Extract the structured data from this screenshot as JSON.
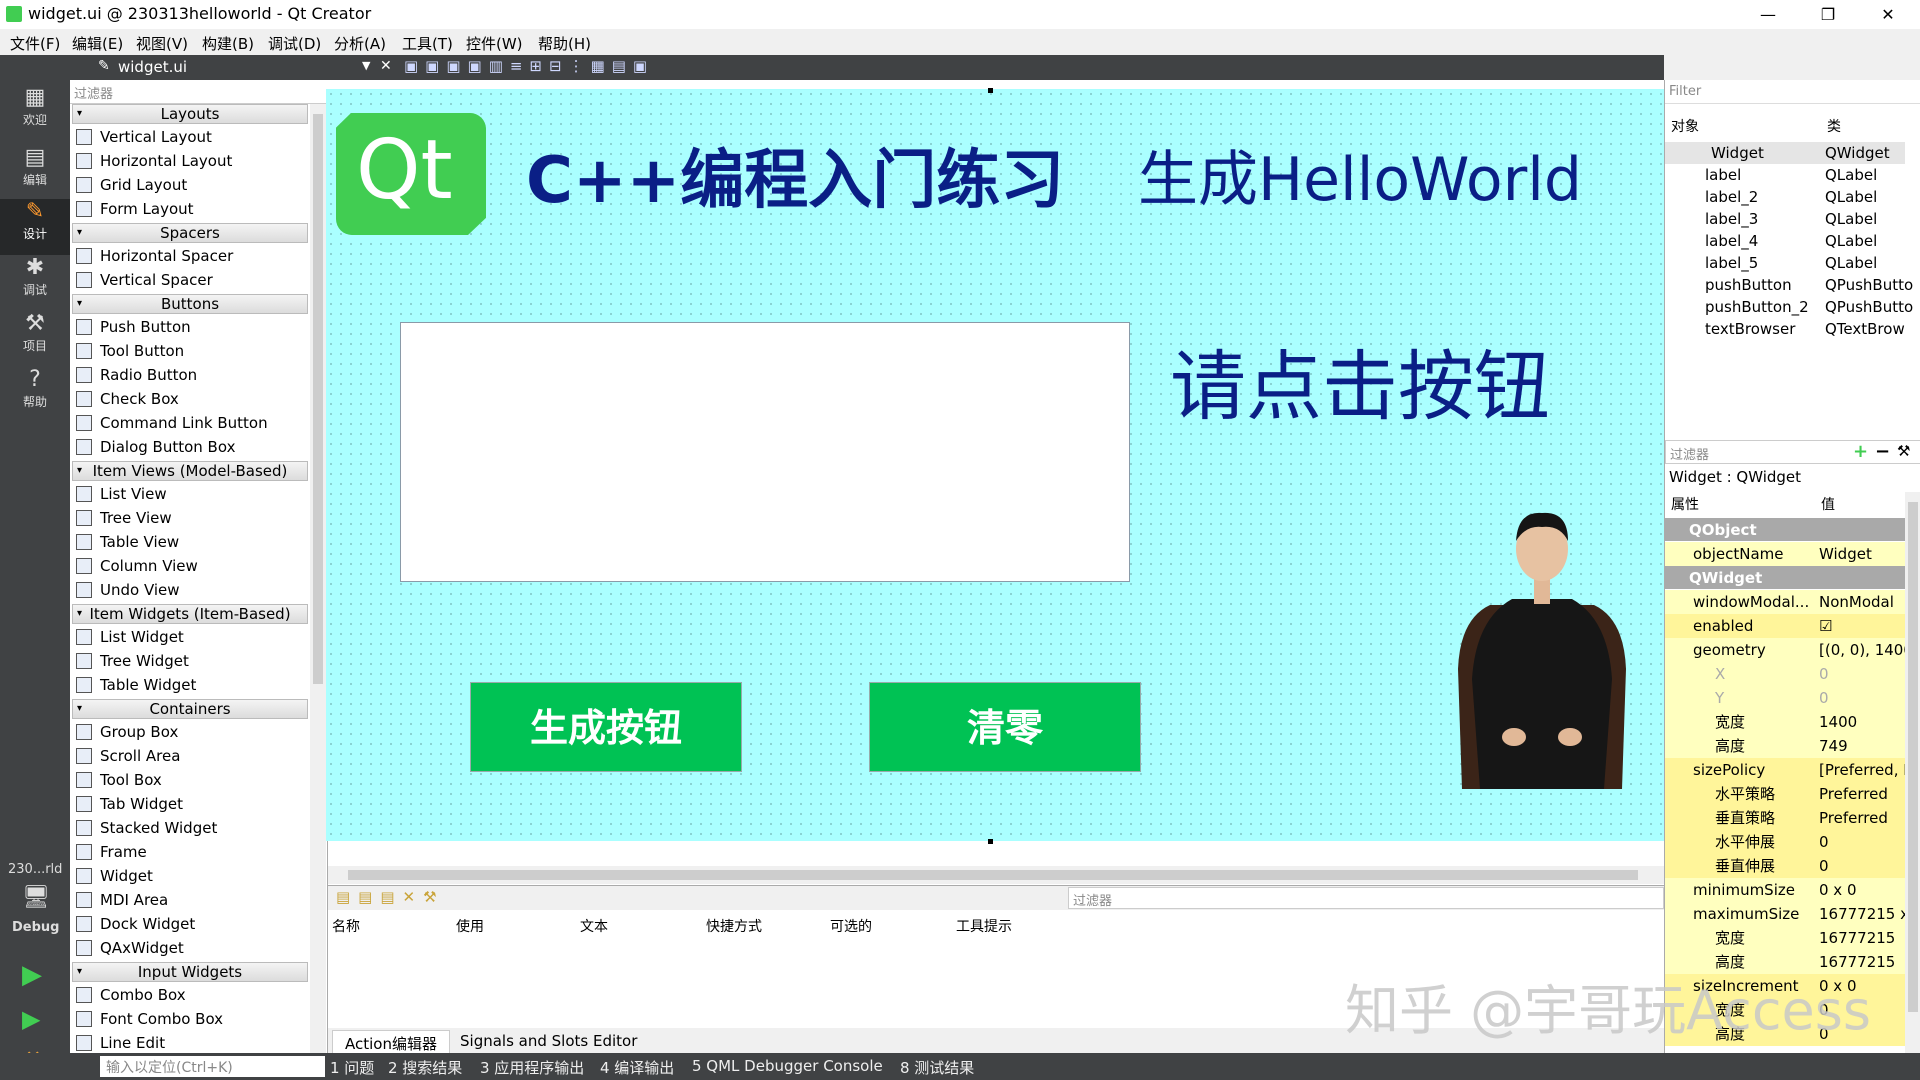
{
  "window": {
    "title": "widget.ui @ 230313helloworld - Qt Creator",
    "controls": [
      "—",
      "❐",
      "✕"
    ]
  },
  "menu": [
    "文件(F)",
    "编辑(E)",
    "视图(V)",
    "构建(B)",
    "调试(D)",
    "分析(A)",
    "工具(T)",
    "控件(W)",
    "帮助(H)"
  ],
  "modes": [
    {
      "label": "欢迎",
      "icon": "grid-icon"
    },
    {
      "label": "编辑",
      "icon": "document-icon"
    },
    {
      "label": "设计",
      "icon": "pencil-icon"
    },
    {
      "label": "调试",
      "icon": "bug-icon"
    },
    {
      "label": "项目",
      "icon": "wrench-icon"
    },
    {
      "label": "帮助",
      "icon": "help-icon"
    }
  ],
  "kit": {
    "project": "230...rld",
    "config": "Debug"
  },
  "editor": {
    "filename": "widget.ui"
  },
  "widgetbox": {
    "filter_placeholder": "过滤器",
    "categories": [
      {
        "name": "Layouts",
        "items": [
          "Vertical Layout",
          "Horizontal Layout",
          "Grid Layout",
          "Form Layout"
        ]
      },
      {
        "name": "Spacers",
        "items": [
          "Horizontal Spacer",
          "Vertical Spacer"
        ]
      },
      {
        "name": "Buttons",
        "items": [
          "Push Button",
          "Tool Button",
          "Radio Button",
          "Check Box",
          "Command Link Button",
          "Dialog Button Box"
        ]
      },
      {
        "name": "Item Views (Model-Based)",
        "items": [
          "List View",
          "Tree View",
          "Table View",
          "Column View",
          "Undo View"
        ]
      },
      {
        "name": "Item Widgets (Item-Based)",
        "items": [
          "List Widget",
          "Tree Widget",
          "Table Widget"
        ]
      },
      {
        "name": "Containers",
        "items": [
          "Group Box",
          "Scroll Area",
          "Tool Box",
          "Tab Widget",
          "Stacked Widget",
          "Frame",
          "Widget",
          "MDI Area",
          "Dock Widget",
          "QAxWidget"
        ]
      },
      {
        "name": "Input Widgets",
        "items": [
          "Combo Box",
          "Font Combo Box",
          "Line Edit"
        ]
      }
    ]
  },
  "form": {
    "logo_text": "Qt",
    "title": "C++编程入门练习",
    "hello": "生成HelloWorld",
    "prompt": "请点击按钮",
    "button_generate": "生成按钮",
    "button_clear": "清零"
  },
  "action_editor": {
    "filter_placeholder": "过滤器",
    "columns": [
      "名称",
      "使用",
      "文本",
      "快捷方式",
      "可选的",
      "工具提示"
    ],
    "tabs": [
      "Action编辑器",
      "Signals and Slots Editor"
    ]
  },
  "object_inspector": {
    "filter_placeholder": "Filter",
    "headers": [
      "对象",
      "类"
    ],
    "rows": [
      {
        "name": "Widget",
        "class": "QWidget"
      },
      {
        "name": "label",
        "class": "QLabel"
      },
      {
        "name": "label_2",
        "class": "QLabel"
      },
      {
        "name": "label_3",
        "class": "QLabel"
      },
      {
        "name": "label_4",
        "class": "QLabel"
      },
      {
        "name": "label_5",
        "class": "QLabel"
      },
      {
        "name": "pushButton",
        "class": "QPushButto"
      },
      {
        "name": "pushButton_2",
        "class": "QPushButto"
      },
      {
        "name": "textBrowser",
        "class": "QTextBrow"
      }
    ]
  },
  "property_editor": {
    "filter_placeholder": "过滤器",
    "title": "Widget : QWidget",
    "headers": [
      "属性",
      "值"
    ],
    "rows": [
      {
        "k": "QObject",
        "v": "",
        "type": "section"
      },
      {
        "k": "objectName",
        "v": "Widget",
        "type": "y"
      },
      {
        "k": "QWidget",
        "v": "",
        "type": "section"
      },
      {
        "k": "windowModal...",
        "v": "NonModal",
        "type": "y"
      },
      {
        "k": "enabled",
        "v": "☑",
        "type": "yy"
      },
      {
        "k": "geometry",
        "v": "[(0, 0), 1400",
        "type": "y"
      },
      {
        "k": "X",
        "v": "0",
        "type": "ysub-muted"
      },
      {
        "k": "Y",
        "v": "0",
        "type": "ysub-muted"
      },
      {
        "k": "宽度",
        "v": "1400",
        "type": "ysub"
      },
      {
        "k": "高度",
        "v": "749",
        "type": "ysub"
      },
      {
        "k": "sizePolicy",
        "v": "[Preferred, I",
        "type": "yy"
      },
      {
        "k": "水平策略",
        "v": "Preferred",
        "type": "yysub"
      },
      {
        "k": "垂直策略",
        "v": "Preferred",
        "type": "yysub"
      },
      {
        "k": "水平伸展",
        "v": "0",
        "type": "yysub"
      },
      {
        "k": "垂直伸展",
        "v": "0",
        "type": "yysub"
      },
      {
        "k": "minimumSize",
        "v": "0 x 0",
        "type": "y"
      },
      {
        "k": "maximumSize",
        "v": "16777215 x",
        "type": "y"
      },
      {
        "k": "宽度",
        "v": "16777215",
        "type": "ysub"
      },
      {
        "k": "高度",
        "v": "16777215",
        "type": "ysub"
      },
      {
        "k": "sizeIncrement",
        "v": "0 x 0",
        "type": "yy"
      },
      {
        "k": "宽度",
        "v": "0",
        "type": "yysub"
      },
      {
        "k": "高度",
        "v": "0",
        "type": "yysub"
      }
    ]
  },
  "statusbar": {
    "locator_placeholder": "输入以定位(Ctrl+K)",
    "tabs": [
      "1 问题",
      "2 搜索结果",
      "3 应用程序输出",
      "4 编译输出",
      "5 QML Debugger Console",
      "8 测试结果"
    ]
  },
  "watermark": "知乎 @宇哥玩Access",
  "colors": {
    "accent": "#41cd52",
    "form_bg": "#aaffff",
    "label_text": "#0a1f86",
    "button_bg": "#00c254"
  }
}
